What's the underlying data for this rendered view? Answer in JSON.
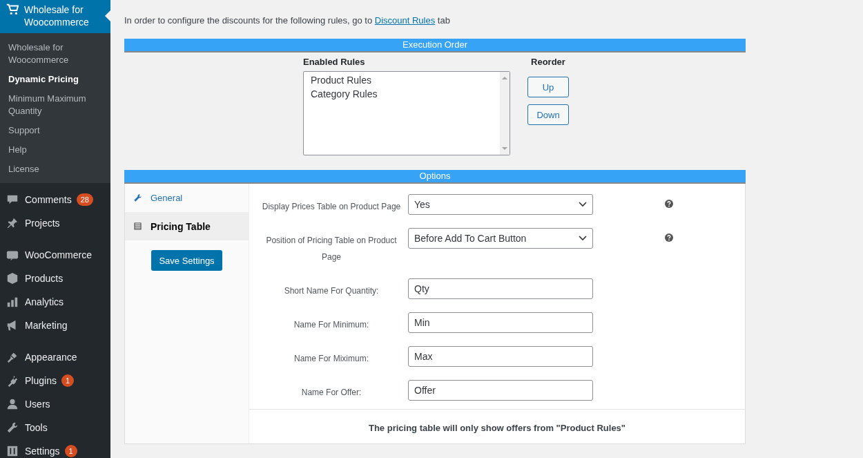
{
  "sidebar": {
    "current": {
      "label": "Wholesale for Woocommerce",
      "selected": true
    },
    "submenu": [
      {
        "label": "Wholesale for Woocommerce",
        "selected": false
      },
      {
        "label": "Dynamic Pricing",
        "selected": true
      },
      {
        "label": "Minimum Maximum Quantity",
        "selected": false
      },
      {
        "label": "Support",
        "selected": false
      },
      {
        "label": "Help",
        "selected": false
      },
      {
        "label": "License",
        "selected": false
      }
    ],
    "groups": [
      [
        {
          "label": "Comments",
          "badge": "28"
        },
        {
          "label": "Projects"
        }
      ],
      [
        {
          "label": "WooCommerce"
        },
        {
          "label": "Products"
        },
        {
          "label": "Analytics"
        },
        {
          "label": "Marketing"
        }
      ],
      [
        {
          "label": "Appearance"
        },
        {
          "label": "Plugins",
          "badge": "1"
        },
        {
          "label": "Users"
        },
        {
          "label": "Tools"
        },
        {
          "label": "Settings",
          "badge": "1"
        }
      ]
    ]
  },
  "intro": {
    "before": "In order to configure the discounts for the following rules, go to",
    "link": "Discount Rules",
    "after": "tab"
  },
  "execution_order": {
    "title": "Execution Order",
    "enabled_rules_label": "Enabled Rules",
    "rules": [
      {
        "label": "Product Rules",
        "selected": false
      },
      {
        "label": "Category Rules",
        "selected": false
      }
    ],
    "reorder_label": "Reorder",
    "buttons": [
      "Up",
      "Down"
    ]
  },
  "options": {
    "title": "Options",
    "tabs": [
      {
        "label": "General",
        "selected": false
      },
      {
        "label": "Pricing Table",
        "selected": true
      }
    ],
    "save_button": "Save Settings",
    "fields": [
      {
        "kind": "select",
        "label": "Display Prices Table on Product Page",
        "value": "Yes",
        "help": true
      },
      {
        "kind": "select",
        "label": "Position of Pricing Table on Product Page",
        "value": "Before Add To Cart Button",
        "help": true
      },
      {
        "kind": "text",
        "label": "Short Name For Quantity:",
        "value": "Qty",
        "help": false
      },
      {
        "kind": "text",
        "label": "Name For Minimum:",
        "value": "Min",
        "help": false
      },
      {
        "kind": "text",
        "label": "Name For Miximum:",
        "value": "Max",
        "help": false
      },
      {
        "kind": "text",
        "label": "Name For Offer:",
        "value": "Offer",
        "help": false
      }
    ],
    "note": "The pricing table will only show offers from \"Product Rules\""
  }
}
